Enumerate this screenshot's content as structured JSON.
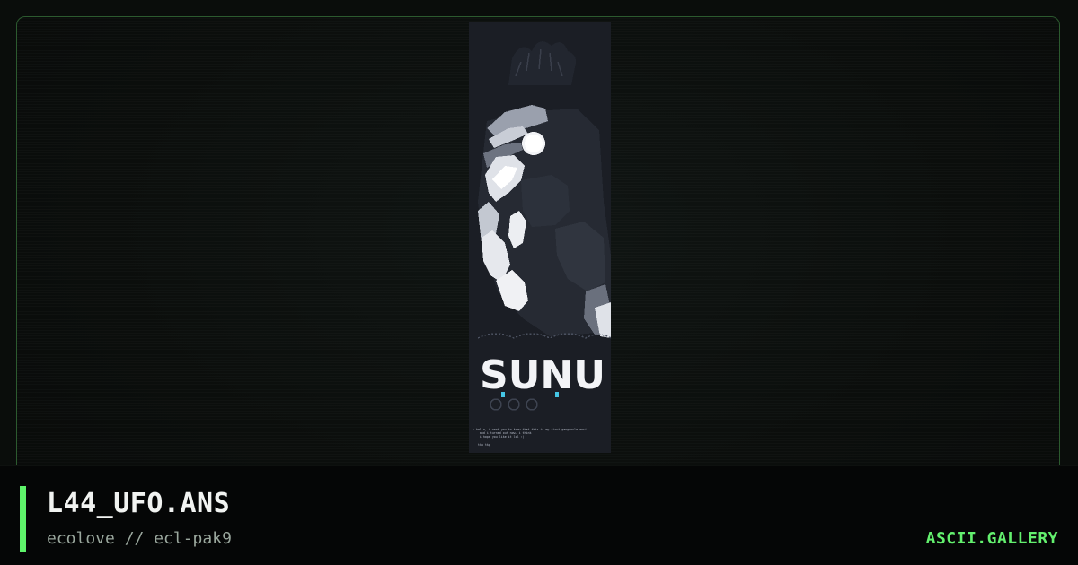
{
  "artwork": {
    "logo_text": "SUNU",
    "caption_lines": [
      "-= hello, i want you to know that this is my first gangsoule ansi",
      "     and i turned out now. i think",
      "     i hope you like it lol :)"
    ],
    "signature": "tkp tkp"
  },
  "info": {
    "title": "L44_UFO.ANS",
    "subtitle": "ecolove // ecl-pak9",
    "brand": "ASCII.GALLERY"
  },
  "colors": {
    "accent": "#5ef36a",
    "brand": "#63f06e",
    "frame_border": "#2c5a2f"
  }
}
